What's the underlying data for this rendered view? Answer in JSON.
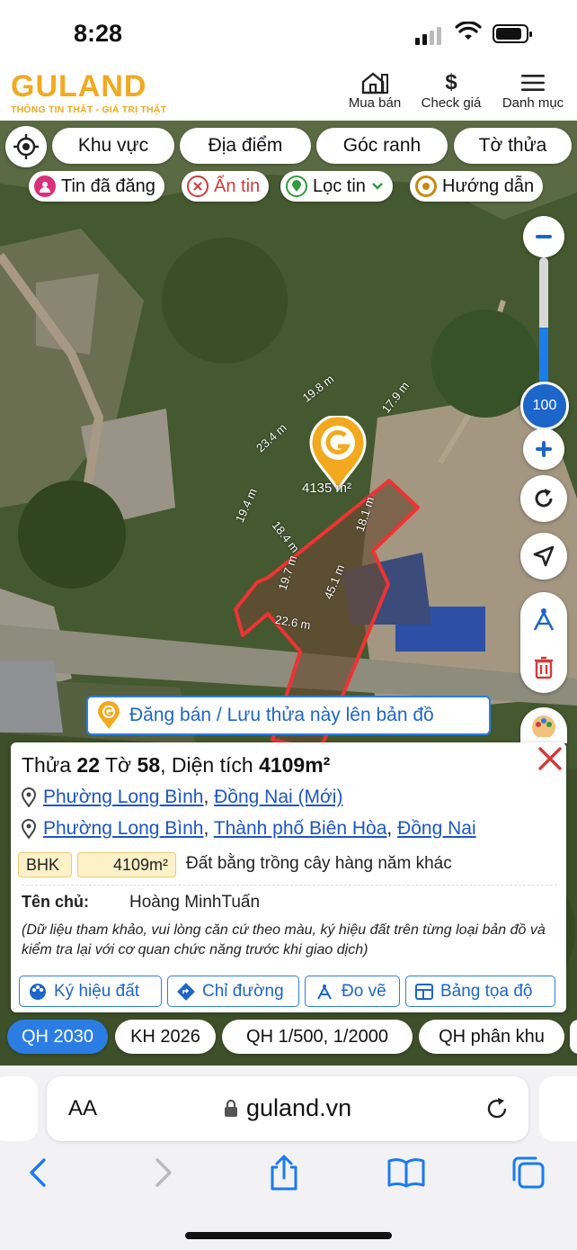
{
  "status": {
    "time": "8:28"
  },
  "header": {
    "brand": "GULAND",
    "slogan": "THÔNG TIN THẬT - GIÁ TRỊ THẬT",
    "buy_sell": "Mua bán",
    "check_price": "Check giá",
    "menu": "Danh mục",
    "dollar_glyph": "$",
    "brand_color": "#f3a91d"
  },
  "map": {
    "search_chips": [
      "Khu vực",
      "Địa điểm",
      "Góc ranh",
      "Tờ thửa"
    ],
    "posted": "Tin đã đăng",
    "hidden": "Ẩn tin",
    "filter": "Lọc tin",
    "guide": "Hướng dẫn",
    "zoom_level": "100",
    "zoom_fraction": 0.45,
    "parcel_area_label": "4135 m²",
    "edge_labels": {
      "e1": "19.8 m",
      "e2": "17.9 m",
      "e3": "23.4 m",
      "e4": "19.4 m",
      "e5": "18.4 m",
      "e6": "19.7 m",
      "e7": "18.1 m",
      "e8": "45.1 m",
      "e9": "22.6 m"
    },
    "post_banner": "Đăng bán / Lưu thửa này lên bản đồ",
    "accent": "#2b7de4"
  },
  "parcel": {
    "title_prefix": "Thửa",
    "plot_no": "22",
    "sheet_word": "Tờ",
    "sheet_no": "58",
    "area_word": ", Diện tích",
    "area": "4109m²",
    "addr_new": {
      "ward": "Phường Long Bình",
      "province": "Đồng Nai (Mới)"
    },
    "addr_old": {
      "ward": "Phường Long Bình",
      "city": "Thành phố Biên Hòa",
      "province": "Đồng Nai"
    },
    "land_code": "BHK",
    "land_area": "4109m²",
    "land_desc": "Đất bằng trồng cây hàng năm khác",
    "owner_label": "Tên chủ:",
    "owner_name": "Hoàng MinhTuấn",
    "note": "(Dữ liệu tham khảo, vui lòng căn cứ theo màu, ký hiệu đất trên từng loại bản đồ và kiểm tra lại với cơ quan chức năng trước khi giao dịch)",
    "buttons": [
      "Ký hiệu đất",
      "Chỉ đường",
      "Đo vẽ",
      "Bảng tọa độ"
    ]
  },
  "plans": [
    "QH 2030",
    "KH 2026",
    "QH 1/500, 1/2000",
    "QH phân khu"
  ],
  "browser": {
    "aa": "AA",
    "url": "guland.vn"
  }
}
